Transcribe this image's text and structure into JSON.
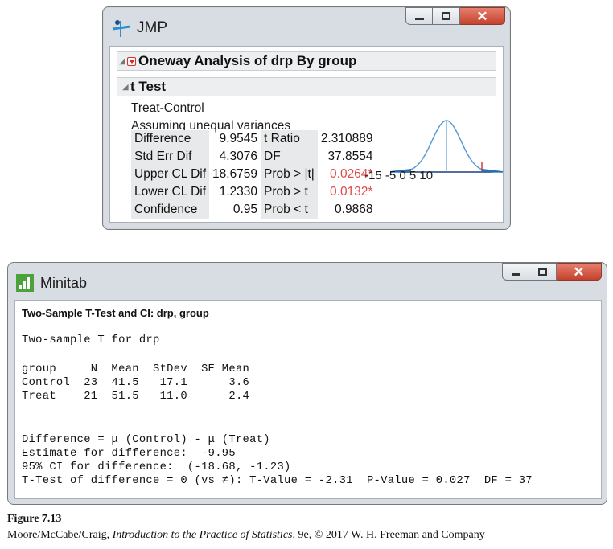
{
  "jmp": {
    "title": "JMP",
    "report_title": "Oneway Analysis of drp By group",
    "section_title": "t Test",
    "comparison": "Treat-Control",
    "assumption": "Assuming unequal variances",
    "rows": [
      {
        "label": "Difference",
        "value": "9.9545",
        "stat": "t Ratio",
        "stat_value": "2.310889",
        "highlight": false
      },
      {
        "label": "Std Err Dif",
        "value": "4.3076",
        "stat": "DF",
        "stat_value": "37.8554",
        "highlight": false
      },
      {
        "label": "Upper CL Dif",
        "value": "18.6759",
        "stat": "Prob > |t|",
        "stat_value": "0.0264*",
        "highlight": true
      },
      {
        "label": "Lower CL Dif",
        "value": "1.2330",
        "stat": "Prob > t",
        "stat_value": "0.0132*",
        "highlight": true
      },
      {
        "label": "Confidence",
        "value": "0.95",
        "stat": "Prob < t",
        "stat_value": "0.9868",
        "highlight": false
      }
    ],
    "axis_ticks": "-15   -5  0  5  10",
    "highlight_color": "#e04a4a",
    "curve_color": "#5b9bd5"
  },
  "minitab": {
    "title": "Minitab",
    "heading": "Two-Sample T-Test and CI: drp, group",
    "subheading": "Two-sample T for drp",
    "table_header": "group     N  Mean  StDev  SE Mean",
    "table_row_1": "Control  23  41.5   17.1      3.6",
    "table_row_2": "Treat    21  51.5   11.0      2.4",
    "diff_line": "Difference = μ (Control) - μ (Treat)",
    "estimate_line": "Estimate for difference:  -9.95",
    "ci_line": "95% CI for difference:  (-18.68, -1.23)",
    "test_line": "T-Test of difference = 0 (vs ≠): T-Value = -2.31  P-Value = 0.027  DF = 37",
    "logo_color": "#49a33a"
  },
  "caption": {
    "figure": "Figure 7.13",
    "authors": "Moore/McCabe/Craig, ",
    "book": "Introduction to the Practice of Statistics",
    "edition": ", 9e, © 2017 W. H. Freeman and Company"
  },
  "icons": [
    "jmp-logo-icon",
    "minitab-logo-icon",
    "minimize-icon",
    "maximize-icon",
    "close-icon",
    "disclosure-icon",
    "red-triangle-menu-icon"
  ]
}
